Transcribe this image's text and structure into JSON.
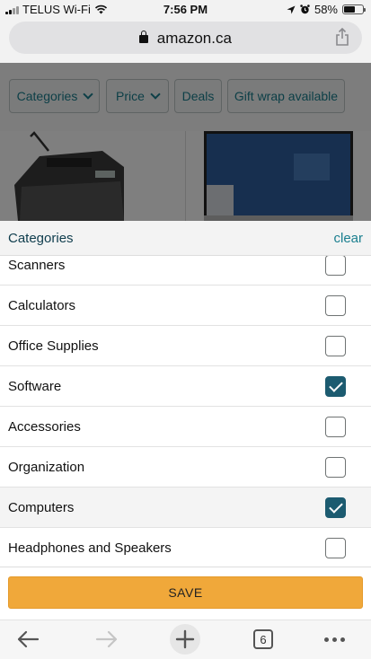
{
  "status_bar": {
    "carrier": "TELUS Wi-Fi",
    "time": "7:56 PM",
    "battery": "58%",
    "battery_level": 0.58
  },
  "browser": {
    "url": "amazon.ca",
    "tab_count": "6"
  },
  "filter_chips": [
    {
      "label": "Categories"
    },
    {
      "label": "Price"
    },
    {
      "label": "Deals"
    },
    {
      "label": "Gift wrap available"
    }
  ],
  "sheet": {
    "title": "Categories",
    "clear_label": "clear",
    "items": [
      {
        "label": "Scanners",
        "checked": false
      },
      {
        "label": "Calculators",
        "checked": false
      },
      {
        "label": "Office Supplies",
        "checked": false
      },
      {
        "label": "Software",
        "checked": true
      },
      {
        "label": "Accessories",
        "checked": false
      },
      {
        "label": "Organization",
        "checked": false
      },
      {
        "label": "Computers",
        "checked": true
      },
      {
        "label": "Headphones and Speakers",
        "checked": false
      }
    ],
    "save_label": "SAVE"
  },
  "colors": {
    "accent": "#1a7f8f",
    "checkbox_checked": "#1c5b70",
    "save_button": "#f0a83a"
  }
}
